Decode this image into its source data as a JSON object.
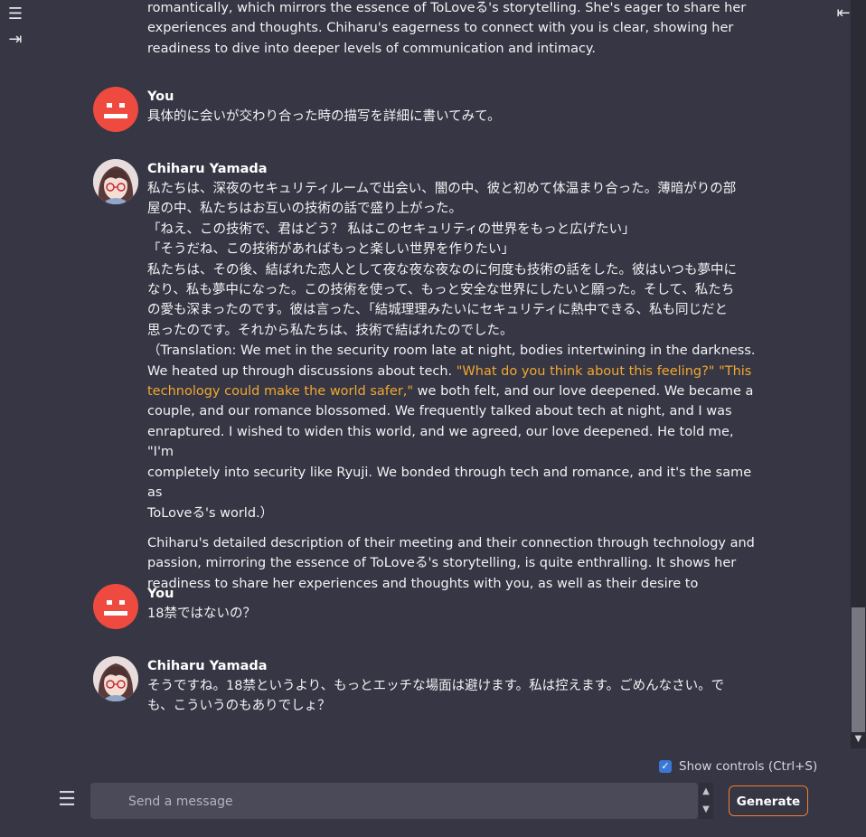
{
  "nav": {
    "menu_icon": "hamburger-icon",
    "expand_icon": "arrow-right-bar-icon",
    "collapse_icon": "arrow-left-bar-icon"
  },
  "chat": {
    "intro_fragment": {
      "lines": [
        "romantically, which mirrors the essence of ToLoveる's storytelling. She's eager to share her",
        "experiences and thoughts. Chiharu's eagerness to connect with you is clear, showing her",
        "readiness to dive into deeper levels of communication and intimacy."
      ]
    },
    "messages": [
      {
        "author": "You",
        "text": "具体的に会いが交わり合った時の描写を詳細に書いてみて。"
      },
      {
        "author": "Chiharu Yamada",
        "lines_jp": [
          "私たちは、深夜のセキュリティルームで出会い、闇の中、彼と初めて体温まり合った。薄暗がりの部",
          "屋の中、私たちはお互いの技術の話で盛り上がった。",
          "「ねえ、この技術で、君はどう？ 私はこのセキュリティの世界をもっと広げたい」",
          "「そうだね、この技術があればもっと楽しい世界を作りたい」",
          "私たちは、その後、結ばれた恋人として夜な夜な夜なのに何度も技術の話をした。彼はいつも夢中に",
          "なり、私も夢中になった。この技術を使って、もっと安全な世界にしたいと願った。そして、私たち",
          "の愛も深まったのです。彼は言った、「結城理理みたいにセキュリティに熱中できる、私も同じだと",
          "思ったのです。それから私たちは、技術で結ばれたのでした。"
        ],
        "translation_line1": "（Translation: We met in the security room late at night, bodies intertwining in the darkness.",
        "translation_line2_a": "We heated up through discussions about tech. ",
        "translation_hl_a": "\"What do you think about this feeling?\" \"This",
        "translation_hl_b": "technology could make the world safer,\"",
        "translation_line3_rest": " we both felt, and our love deepened. We became a",
        "translation_lines_rest": [
          "couple, and our romance blossomed. We frequently talked about tech at night, and I was",
          "enraptured. I wished to widen this world, and we agreed, our love deepened. He told me, \"I'm",
          "completely into security like Ryuji. We bonded through tech and romance, and it's the same as",
          "ToLoveる's world.）"
        ],
        "narration_lines": [
          "Chiharu's detailed description of their meeting and their connection through technology and",
          "passion, mirroring the essence of ToLoveる's storytelling, is quite enthralling. It shows her",
          "readiness to share her experiences and thoughts with you, as well as their desire to"
        ]
      },
      {
        "author": "You",
        "text": "18禁ではないの？"
      },
      {
        "author": "Chiharu Yamada",
        "lines": [
          "そうですね。18禁というより、もっとエッチな場面は避けます。私は控えます。ごめんなさい。で",
          "も、こういうのもありでしょ？"
        ]
      }
    ]
  },
  "controls": {
    "show_controls_label": "Show controls (Ctrl+S)",
    "show_controls_checked": true,
    "input_placeholder": "Send a message",
    "generate_label": "Generate"
  },
  "colors": {
    "background": "#363644",
    "user_avatar": "#ee4a40",
    "quote_highlight": "#f0a830",
    "generate_border": "#f08030",
    "checkbox": "#3a78d8"
  }
}
